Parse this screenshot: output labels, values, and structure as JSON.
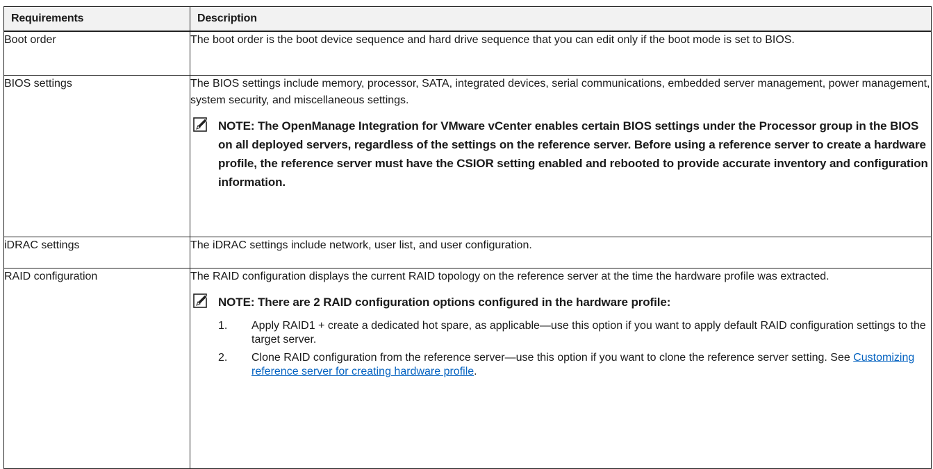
{
  "header": {
    "col1": "Requirements",
    "col2": "Description"
  },
  "rows": [
    {
      "requirement": "Boot order",
      "description": "The boot order is the boot device sequence and hard drive sequence that you can edit only if the boot mode is set to BIOS."
    },
    {
      "requirement": "BIOS settings",
      "description": "The BIOS settings include memory, processor, SATA, integrated devices, serial communications, embedded server management, power management, system security, and miscellaneous settings.",
      "note": "NOTE: The OpenManage Integration for VMware vCenter enables certain BIOS settings under the Processor group in the BIOS on all deployed servers, regardless of the settings on the reference server. Before using a reference server to create a hardware profile, the reference server must have the CSIOR setting enabled and rebooted to provide accurate inventory and configuration information."
    },
    {
      "requirement": "iDRAC settings",
      "description": "The iDRAC settings include network, user list, and user configuration."
    },
    {
      "requirement": "RAID configuration",
      "description": "The RAID configuration displays the current RAID topology on the reference server at the time the hardware profile was extracted.",
      "note": "NOTE: There are 2 RAID configuration options configured in the hardware profile:",
      "steps": [
        {
          "number": "1.",
          "text": "Apply RAID1 + create a dedicated hot spare, as applicable—use this option if you want to apply default RAID configuration settings to the target server."
        },
        {
          "number": "2.",
          "text": "Clone RAID configuration from the reference server—use this option if you want to clone the reference server setting. See ",
          "link": "Customizing reference server for creating hardware profile",
          "suffix": "."
        }
      ]
    }
  ],
  "icons": {
    "note": "pencil-note-icon"
  },
  "colors": {
    "link": "#0563c1",
    "border": "#222222",
    "header_bg": "#f2f2f2"
  }
}
